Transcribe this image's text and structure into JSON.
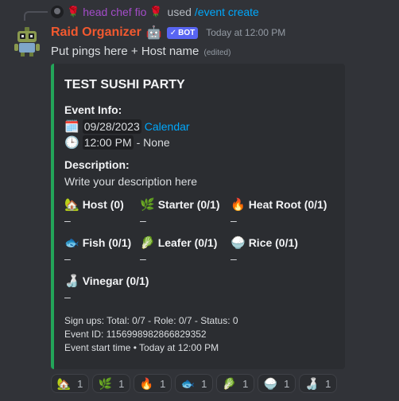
{
  "reply": {
    "user": "head chef fio",
    "used": "used",
    "command": "/event create"
  },
  "message": {
    "author": "Raid Organizer",
    "bot_tag": "BOT",
    "timestamp": "Today at 12:00 PM",
    "content": "Put pings here + Host name",
    "edited": "(edited)"
  },
  "embed": {
    "accent_color": "#23a559",
    "title": "TEST SUSHI PARTY",
    "event_info_label": "Event Info:",
    "date": "09/28/2023",
    "calendar_link": "Calendar",
    "time": "12:00 PM",
    "time_suffix": "- None",
    "description_label": "Description:",
    "description": "Write your description here",
    "roles": [
      {
        "icon": "house-icon",
        "glyph": "🏡",
        "name": "Host (0)",
        "value": "–"
      },
      {
        "icon": "herb-icon",
        "glyph": "🌿",
        "name": "Starter (0/1)",
        "value": "–"
      },
      {
        "icon": "fire-icon",
        "glyph": "🔥",
        "name": "Heat Root (0/1)",
        "value": "–"
      },
      {
        "icon": "fish-icon",
        "glyph": "🐟",
        "name": "Fish (0/1)",
        "value": "–"
      },
      {
        "icon": "leaf-icon",
        "glyph": "🥬",
        "name": "Leafer (0/1)",
        "value": "–"
      },
      {
        "icon": "rice-icon",
        "glyph": "🍚",
        "name": "Rice (0/1)",
        "value": "–"
      },
      {
        "icon": "vinegar-icon",
        "glyph": "🍶",
        "name": "Vinegar (0/1)",
        "value": "–"
      }
    ],
    "footer": {
      "signups": "Sign ups: Total: 0/7 - Role: 0/7 - Status: 0",
      "event_id": "Event ID: 1156998982866829352",
      "start_time": "Event start time • Today at 12:00 PM"
    }
  },
  "reactions": [
    {
      "icon": "house-icon",
      "glyph": "🏡",
      "count": "1"
    },
    {
      "icon": "herb-icon",
      "glyph": "🌿",
      "count": "1"
    },
    {
      "icon": "fire-icon",
      "glyph": "🔥",
      "count": "1"
    },
    {
      "icon": "fish-icon",
      "glyph": "🐟",
      "count": "1"
    },
    {
      "icon": "leaf-icon",
      "glyph": "🥬",
      "count": "1"
    },
    {
      "icon": "rice-icon",
      "glyph": "🍚",
      "count": "1"
    },
    {
      "icon": "vinegar-icon",
      "glyph": "🍶",
      "count": "1"
    }
  ]
}
